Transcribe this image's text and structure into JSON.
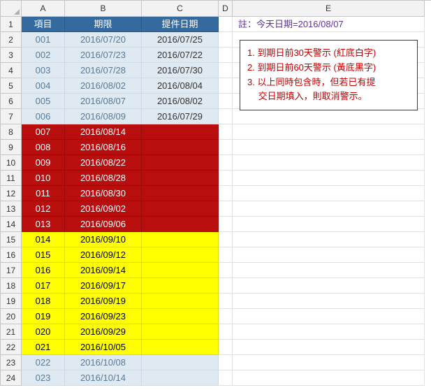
{
  "columns": [
    "A",
    "B",
    "C",
    "D",
    "E"
  ],
  "header": {
    "a": "項目",
    "b": "期限",
    "c": "提件日期"
  },
  "note_e1": "註：今天日期=2016/08/07",
  "notes": {
    "line1": "1. 到期日前30天警示 (紅底白字)",
    "line2": "2. 到期日前60天警示 (黃底黑字)",
    "line3a": "3. 以上同時包含時，但若已有提",
    "line3b": "交日期填入，則取消警示。"
  },
  "rows": [
    {
      "n": 1
    },
    {
      "n": 2,
      "a": "001",
      "b": "2016/07/20",
      "c": "2016/07/25",
      "style": "pale"
    },
    {
      "n": 3,
      "a": "002",
      "b": "2016/07/23",
      "c": "2016/07/22",
      "style": "pale"
    },
    {
      "n": 4,
      "a": "003",
      "b": "2016/07/28",
      "c": "2016/07/30",
      "style": "pale"
    },
    {
      "n": 5,
      "a": "004",
      "b": "2016/08/02",
      "c": "2016/08/04",
      "style": "pale"
    },
    {
      "n": 6,
      "a": "005",
      "b": "2016/08/07",
      "c": "2016/08/02",
      "style": "pale"
    },
    {
      "n": 7,
      "a": "006",
      "b": "2016/08/09",
      "c": "2016/07/29",
      "style": "pale"
    },
    {
      "n": 8,
      "a": "007",
      "b": "2016/08/14",
      "c": "",
      "style": "red"
    },
    {
      "n": 9,
      "a": "008",
      "b": "2016/08/16",
      "c": "",
      "style": "red"
    },
    {
      "n": 10,
      "a": "009",
      "b": "2016/08/22",
      "c": "",
      "style": "red"
    },
    {
      "n": 11,
      "a": "010",
      "b": "2016/08/28",
      "c": "",
      "style": "red"
    },
    {
      "n": 12,
      "a": "011",
      "b": "2016/08/30",
      "c": "",
      "style": "red"
    },
    {
      "n": 13,
      "a": "012",
      "b": "2016/09/02",
      "c": "",
      "style": "red"
    },
    {
      "n": 14,
      "a": "013",
      "b": "2016/09/06",
      "c": "",
      "style": "red"
    },
    {
      "n": 15,
      "a": "014",
      "b": "2016/09/10",
      "c": "",
      "style": "yel"
    },
    {
      "n": 16,
      "a": "015",
      "b": "2016/09/12",
      "c": "",
      "style": "yel"
    },
    {
      "n": 17,
      "a": "016",
      "b": "2016/09/14",
      "c": "",
      "style": "yel"
    },
    {
      "n": 18,
      "a": "017",
      "b": "2016/09/17",
      "c": "",
      "style": "yel"
    },
    {
      "n": 19,
      "a": "018",
      "b": "2016/09/19",
      "c": "",
      "style": "yel"
    },
    {
      "n": 20,
      "a": "019",
      "b": "2016/09/23",
      "c": "",
      "style": "yel"
    },
    {
      "n": 21,
      "a": "020",
      "b": "2016/09/29",
      "c": "",
      "style": "yel"
    },
    {
      "n": 22,
      "a": "021",
      "b": "2016/10/05",
      "c": "",
      "style": "yel"
    },
    {
      "n": 23,
      "a": "022",
      "b": "2016/10/08",
      "c": "",
      "style": "pale"
    },
    {
      "n": 24,
      "a": "023",
      "b": "2016/10/14",
      "c": "",
      "style": "pale"
    }
  ]
}
